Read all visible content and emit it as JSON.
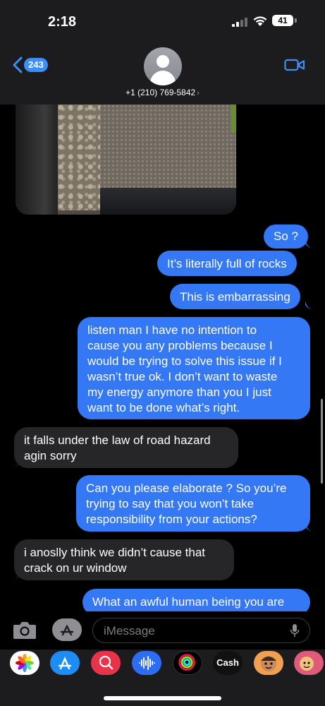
{
  "status_bar": {
    "time": "2:18",
    "battery": "41"
  },
  "header": {
    "back_count": "243",
    "contact": "+1 (210) 769-5842",
    "contact_chevron": "›"
  },
  "messages": [
    {
      "from": "me",
      "text": "So ?"
    },
    {
      "from": "me",
      "text": "It’s literally full of rocks"
    },
    {
      "from": "me",
      "text": "This is embarrassing"
    },
    {
      "from": "me",
      "text": "listen man I have no intention to\ncause you any problems because I\nwould be trying to solve this issue if I\nwasn’t true ok. I don’t want to waste\nmy energy anymore than you I just\nwant to be done what’s right."
    },
    {
      "from": "them",
      "text": "it falls under the law of road hazard\nagin sorry"
    },
    {
      "from": "me",
      "text": "Can you please elaborate ? So you’re\ntrying to say that you won’t take\nresponsibility from your actions?"
    },
    {
      "from": "them",
      "text": "i anoslly think we didn’t cause that\ncrack on ur window"
    },
    {
      "from": "me",
      "text": "What an awful human being you are"
    }
  ],
  "composer": {
    "placeholder": "iMessage"
  },
  "app_drawer": [
    {
      "name": "photos-app-icon"
    },
    {
      "name": "app-store-icon"
    },
    {
      "name": "image-search-icon"
    },
    {
      "name": "audio-message-icon"
    },
    {
      "name": "fitness-icon"
    },
    {
      "name": "cash-app-icon",
      "label": "Cash"
    },
    {
      "name": "memoji-icon"
    },
    {
      "name": "memoji-stickers-icon"
    }
  ],
  "colors": {
    "sent_bubble": "#3478f6",
    "received_bubble": "#262628",
    "accent": "#3e8ff5",
    "background": "#000000"
  }
}
